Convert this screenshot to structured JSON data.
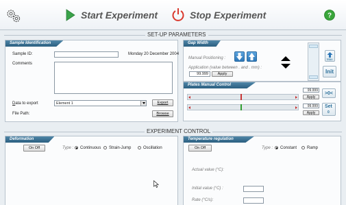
{
  "toolbar": {
    "settings_icon": "gears-icon",
    "start_label": "Start Experiment",
    "stop_label": "Stop Experiment",
    "help_icon": "help-icon"
  },
  "setup": {
    "heading": "SET-UP PARAMETERS",
    "sample": {
      "title": "Sample Identification",
      "sample_id_label": "Sample ID:",
      "sample_id_value": "",
      "date": "Monday 20 December 2004",
      "comments_label": "Comments",
      "data_export_label": "Data to export",
      "data_export_value": "Element 1",
      "export_button": "Export",
      "file_path_label": "File Path:",
      "browse_button": "Browse"
    },
    "gap": {
      "title": "Gap Width",
      "manual_label": "Manual Positioning :",
      "app_label": "Application (value between . and . mm) :",
      "gap_value": "99.999",
      "apply": "Apply",
      "max_label": "Max",
      "init_label": "Init"
    },
    "plates": {
      "title": "Plates Manual Control",
      "value1": "99.999",
      "value2": "99.999",
      "apply": "Apply",
      "zero_label": ">0<",
      "set_label": "Set",
      "set_sub": "0",
      "slider1_pos": 0.48,
      "slider2_pos": 0.48,
      "slider1_color": "#c83232",
      "slider2_color": "#2f9e2f"
    }
  },
  "control": {
    "heading": "EXPERIMENT CONTROL",
    "deformation": {
      "title": "Deformation",
      "onoff": "On Off",
      "type_label": "Type :",
      "options": [
        "Continuous",
        "Strain-Jump",
        "Oscillation"
      ],
      "selected": "Continuous"
    },
    "temperature": {
      "title": "Temperature regulation",
      "onoff": "On Off",
      "type_label": "Type :",
      "options": [
        "Constant",
        "Ramp"
      ],
      "selected": "Constant",
      "actual_label": "Actual value (°C):",
      "initial_label": "Initial value (°C) :",
      "initial_value": "",
      "rate_label": "Rate (°C/s):",
      "rate_value": ""
    }
  },
  "colors": {
    "accent": "#2b6f9a",
    "play": "#3aa34a",
    "stop": "#d9382d",
    "help": "#39a53a"
  }
}
